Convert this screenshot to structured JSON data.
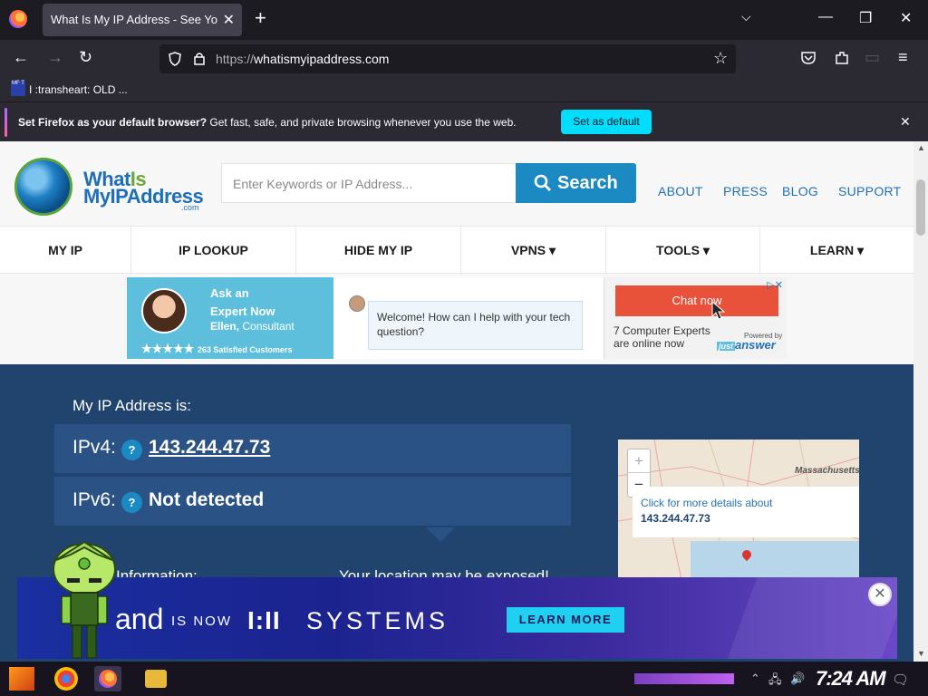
{
  "browser": {
    "tab_title": "What Is My IP Address - See Yo",
    "url_prefix": "https://",
    "url_host": "whatismyipaddress.com",
    "bookmark_icon_text": "MF T",
    "bookmark_label": "I :transheart: OLD ...",
    "notification": {
      "bold": "Set Firefox as your default browser?",
      "text": " Get fast, safe, and private browsing whenever you use the web.",
      "button": "Set as default"
    }
  },
  "site": {
    "logo_line1": "What",
    "logo_line1b": "Is",
    "logo_line2": "MyIPAddress",
    "logo_com": ".com",
    "search_placeholder": "Enter Keywords or IP Address...",
    "search_button": "Search",
    "header_links": [
      "ABOUT",
      "PRESS",
      "BLOG",
      "SUPPORT"
    ],
    "nav": [
      "MY IP",
      "IP LOOKUP",
      "HIDE MY IP",
      "VPNS ▾",
      "TOOLS ▾",
      "LEARN ▾"
    ]
  },
  "ad": {
    "ask_line1": "Ask an",
    "ask_line2": "Expert Now",
    "name": "Ellen,",
    "role": " Consultant",
    "stars": "★★★★★",
    "satisfied": "263 Satisfied Customers",
    "bubble": "Welcome! How can I help with your tech question?",
    "chat": "Chat now",
    "experts_line1": "7 Computer Experts",
    "experts_line2": "are online now",
    "powered_by": "Powered by",
    "brand_just": "just",
    "brand_answer": "answer"
  },
  "ip": {
    "heading": "My IP Address is:",
    "ipv4_label": "IPv4:",
    "ipv4_value": "143.244.47.73",
    "ipv6_label": "IPv6:",
    "ipv6_value": "Not detected",
    "help_badge": "?",
    "info_label": "Information:",
    "exposed": "Your location may be exposed!"
  },
  "map": {
    "popup_line1": "Click for more details about",
    "popup_ip": "143.244.47.73",
    "region_label": "Massachusetts",
    "zoom_in": "+",
    "zoom_out": "−"
  },
  "bottom_ad": {
    "word": "and",
    "is_now": "IS NOW",
    "logo": "I:II",
    "systems": "SYSTEMS",
    "cta": "LEARN MORE"
  },
  "taskbar": {
    "clock": "7:24 AM"
  }
}
